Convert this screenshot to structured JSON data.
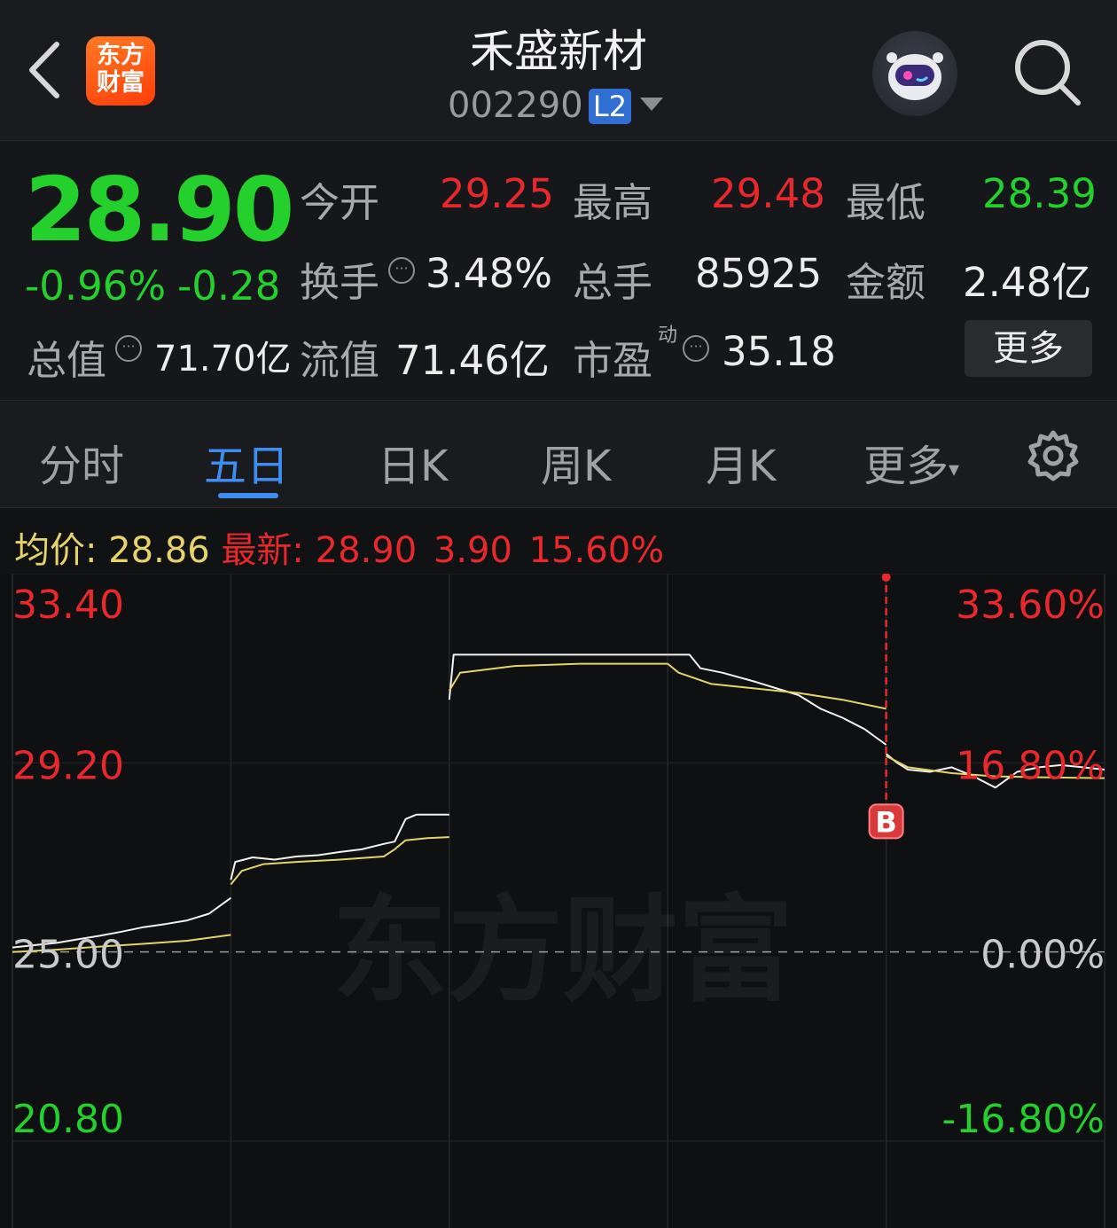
{
  "header": {
    "logo_line1": "东方",
    "logo_line2": "财富",
    "stock_name": "禾盛新材",
    "stock_code": "002290",
    "level_badge": "L2"
  },
  "quote": {
    "price": "28.90",
    "change_pct": "-0.96%",
    "change_amt": "-0.28",
    "open_label": "今开",
    "open": "29.25",
    "high_label": "最高",
    "high": "29.48",
    "low_label": "最低",
    "low": "28.39",
    "turnover_label": "换手",
    "turnover": "3.48%",
    "volume_label": "总手",
    "volume": "85925",
    "amount_label": "金额",
    "amount": "2.48亿",
    "mktcap_label": "总值",
    "mktcap": "71.70亿",
    "float_label": "流值",
    "float_cap": "71.46亿",
    "pe_label": "市盈",
    "pe_sup": "动",
    "pe": "35.18",
    "more": "更多"
  },
  "tabs": [
    "分时",
    "五日",
    "日K",
    "周K",
    "月K",
    "更多"
  ],
  "active_tab": 1,
  "info": {
    "avg_label": "均价:",
    "avg": "28.86",
    "latest_label": "最新:",
    "latest": "28.90",
    "change": "3.90",
    "change_pct": "15.60%"
  },
  "colors": {
    "up": "#e8282a",
    "down": "#24d02c",
    "accent": "#3f8df0",
    "avg_line": "#e6d36a",
    "price_line": "#f2f2f2"
  },
  "icons": [
    "back-arrow-icon",
    "search-icon",
    "info-dots-icon",
    "settings-gear-icon",
    "buy-marker-icon"
  ],
  "chart_data": {
    "type": "line",
    "title": "",
    "y_left_ticks": [
      "33.40",
      "29.20",
      "25.00",
      "20.80"
    ],
    "y_right_ticks": [
      "33.60%",
      "16.80%",
      "0.00%",
      "-16.80%"
    ],
    "ylim": [
      20.8,
      33.4
    ],
    "base_price": 25.0,
    "days": 5,
    "watermark": "东方财富",
    "marker": {
      "label": "B",
      "day": 4,
      "t": 0.0,
      "price": 27.9
    },
    "spike": {
      "day": 4,
      "t": 0.0,
      "price": 33.4
    },
    "series": [
      {
        "name": "价格",
        "day_points": [
          [
            [
              0,
              25.1
            ],
            [
              0.1,
              25.15
            ],
            [
              0.2,
              25.2
            ],
            [
              0.3,
              25.28
            ],
            [
              0.4,
              25.36
            ],
            [
              0.5,
              25.45
            ],
            [
              0.6,
              25.55
            ],
            [
              0.7,
              25.62
            ],
            [
              0.8,
              25.7
            ],
            [
              0.9,
              25.85
            ],
            [
              1.0,
              26.2
            ]
          ],
          [
            [
              0,
              26.6
            ],
            [
              0.02,
              27.0
            ],
            [
              0.1,
              27.1
            ],
            [
              0.2,
              27.05
            ],
            [
              0.3,
              27.12
            ],
            [
              0.4,
              27.15
            ],
            [
              0.5,
              27.22
            ],
            [
              0.6,
              27.28
            ],
            [
              0.7,
              27.4
            ],
            [
              0.75,
              27.45
            ],
            [
              0.8,
              27.95
            ],
            [
              0.85,
              28.05
            ],
            [
              0.9,
              28.05
            ],
            [
              1.0,
              28.05
            ]
          ],
          [
            [
              0,
              30.6
            ],
            [
              0.02,
              31.6
            ],
            [
              0.3,
              31.6
            ],
            [
              0.6,
              31.6
            ],
            [
              1.0,
              31.6
            ]
          ],
          [
            [
              0,
              31.6
            ],
            [
              0.05,
              31.6
            ],
            [
              0.1,
              31.6
            ],
            [
              0.15,
              31.3
            ],
            [
              0.25,
              31.2
            ],
            [
              0.4,
              31.0
            ],
            [
              0.5,
              30.85
            ],
            [
              0.6,
              30.7
            ],
            [
              0.7,
              30.4
            ],
            [
              0.8,
              30.2
            ],
            [
              0.9,
              29.95
            ],
            [
              1.0,
              29.6
            ]
          ],
          [
            [
              0,
              29.4
            ],
            [
              0.05,
              29.2
            ],
            [
              0.1,
              29.05
            ],
            [
              0.2,
              29.0
            ],
            [
              0.3,
              29.1
            ],
            [
              0.4,
              28.9
            ],
            [
              0.5,
              28.65
            ],
            [
              0.6,
              29.0
            ],
            [
              0.7,
              29.1
            ],
            [
              0.8,
              29.15
            ],
            [
              0.9,
              29.1
            ],
            [
              1.0,
              29.05
            ]
          ]
        ]
      },
      {
        "name": "均价",
        "day_points": [
          [
            [
              0,
              25.0
            ],
            [
              0.2,
              25.05
            ],
            [
              0.4,
              25.12
            ],
            [
              0.6,
              25.18
            ],
            [
              0.8,
              25.25
            ],
            [
              1.0,
              25.38
            ]
          ],
          [
            [
              0,
              26.5
            ],
            [
              0.05,
              26.8
            ],
            [
              0.15,
              26.95
            ],
            [
              0.3,
              27.0
            ],
            [
              0.5,
              27.05
            ],
            [
              0.7,
              27.12
            ],
            [
              0.75,
              27.28
            ],
            [
              0.8,
              27.48
            ],
            [
              0.9,
              27.53
            ],
            [
              1.0,
              27.55
            ]
          ],
          [
            [
              0,
              30.8
            ],
            [
              0.05,
              31.2
            ],
            [
              0.3,
              31.35
            ],
            [
              0.6,
              31.4
            ],
            [
              1.0,
              31.4
            ]
          ],
          [
            [
              0,
              31.4
            ],
            [
              0.05,
              31.2
            ],
            [
              0.2,
              30.95
            ],
            [
              0.4,
              30.85
            ],
            [
              0.6,
              30.75
            ],
            [
              0.8,
              30.6
            ],
            [
              1.0,
              30.4
            ]
          ],
          [
            [
              0,
              29.35
            ],
            [
              0.1,
              29.1
            ],
            [
              0.3,
              28.97
            ],
            [
              0.5,
              28.9
            ],
            [
              0.7,
              28.88
            ],
            [
              1.0,
              28.86
            ]
          ]
        ]
      }
    ]
  }
}
